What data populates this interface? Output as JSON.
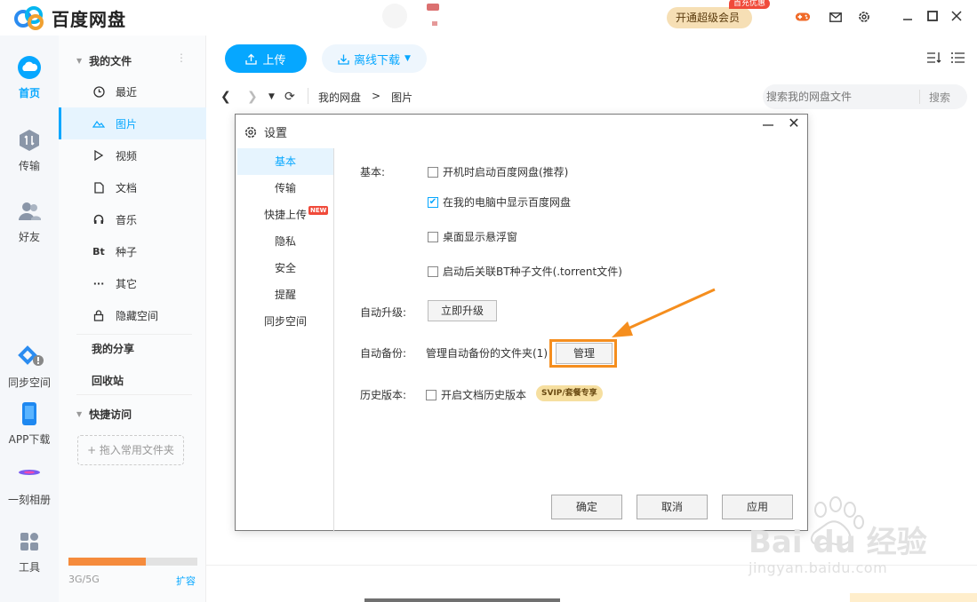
{
  "app": {
    "title": "百度网盘",
    "vip_label": "开通超级会员",
    "vip_badge": "首充优惠"
  },
  "left_nav": [
    {
      "label": "首页",
      "icon": "cloud-icon",
      "active": true
    },
    {
      "label": "传输",
      "icon": "transfer-icon",
      "active": false
    },
    {
      "label": "好友",
      "icon": "friends-icon",
      "active": false
    },
    {
      "label": "同步空间",
      "icon": "sync-space-icon",
      "active": false
    },
    {
      "label": "APP下载",
      "icon": "phone-icon",
      "active": false
    },
    {
      "label": "一刻相册",
      "icon": "album-icon",
      "active": false
    },
    {
      "label": "工具",
      "icon": "tools-icon",
      "active": false
    }
  ],
  "sidebar": {
    "my_files": "我的文件",
    "items": [
      {
        "label": "最近",
        "icon": "clock-icon"
      },
      {
        "label": "图片",
        "icon": "image-icon"
      },
      {
        "label": "视频",
        "icon": "play-icon"
      },
      {
        "label": "文档",
        "icon": "document-icon"
      },
      {
        "label": "音乐",
        "icon": "headphones-icon"
      },
      {
        "label": "种子",
        "icon": "bt-icon",
        "glyph": "Bt"
      },
      {
        "label": "其它",
        "icon": "more-icon",
        "glyph": "···"
      },
      {
        "label": "隐藏空间",
        "icon": "lock-icon"
      }
    ],
    "my_share": "我的分享",
    "recycle": "回收站",
    "quick_access": "快捷访问",
    "drop_hint": "+ 拖入常用文件夹",
    "quota_text": "3G/5G",
    "quota_fraction": 0.6,
    "expand": "扩容"
  },
  "toolbar": {
    "upload": "上传",
    "offline_download": "离线下载"
  },
  "nav": {
    "breadcrumb": [
      "我的网盘",
      ">",
      "图片"
    ],
    "search_placeholder": "搜索我的网盘文件",
    "search_button": "搜索"
  },
  "dialog": {
    "title": "设置",
    "tabs": [
      "基本",
      "传输",
      "快捷上传",
      "隐私",
      "安全",
      "提醒",
      "同步空间"
    ],
    "active_tab": "基本",
    "new_badge": "NEW",
    "basic_label": "基本:",
    "options": [
      {
        "label": "开机时启动百度网盘(推荐)",
        "checked": false
      },
      {
        "label": "在我的电脑中显示百度网盘",
        "checked": true
      },
      {
        "label": "桌面显示悬浮窗",
        "checked": false
      },
      {
        "label": "启动后关联BT种子文件(.torrent文件)",
        "checked": false
      }
    ],
    "auto_upgrade_label": "自动升级:",
    "upgrade_now": "立即升级",
    "auto_backup_label": "自动备份:",
    "backup_desc": "管理自动备份的文件夹(1)",
    "manage": "管理",
    "history_label": "历史版本:",
    "history_option": "开启文档历史版本",
    "history_checked": false,
    "svip_tag": "SVIP/套餐专享",
    "ok": "确定",
    "cancel": "取消",
    "apply": "应用"
  },
  "watermark": {
    "brand": "Bai du 经验",
    "url": "jingyan.baidu.com"
  },
  "colors": {
    "accent": "#06a7ff",
    "highlight": "#f58e1e",
    "quota_fill": "#f58b3c"
  }
}
